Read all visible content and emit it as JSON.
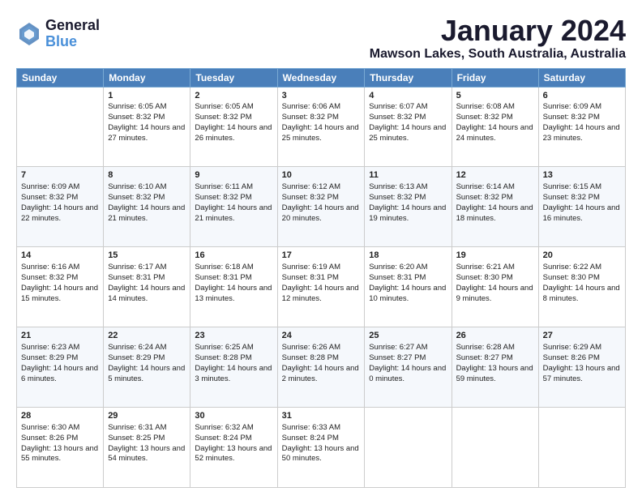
{
  "header": {
    "logo_line1": "General",
    "logo_line2": "Blue",
    "month_title": "January 2024",
    "location": "Mawson Lakes, South Australia, Australia"
  },
  "weekdays": [
    "Sunday",
    "Monday",
    "Tuesday",
    "Wednesday",
    "Thursday",
    "Friday",
    "Saturday"
  ],
  "weeks": [
    [
      {
        "day": "",
        "sunrise": "",
        "sunset": "",
        "daylight": "",
        "empty": true
      },
      {
        "day": "1",
        "sunrise": "Sunrise: 6:05 AM",
        "sunset": "Sunset: 8:32 PM",
        "daylight": "Daylight: 14 hours and 27 minutes."
      },
      {
        "day": "2",
        "sunrise": "Sunrise: 6:05 AM",
        "sunset": "Sunset: 8:32 PM",
        "daylight": "Daylight: 14 hours and 26 minutes."
      },
      {
        "day": "3",
        "sunrise": "Sunrise: 6:06 AM",
        "sunset": "Sunset: 8:32 PM",
        "daylight": "Daylight: 14 hours and 25 minutes."
      },
      {
        "day": "4",
        "sunrise": "Sunrise: 6:07 AM",
        "sunset": "Sunset: 8:32 PM",
        "daylight": "Daylight: 14 hours and 25 minutes."
      },
      {
        "day": "5",
        "sunrise": "Sunrise: 6:08 AM",
        "sunset": "Sunset: 8:32 PM",
        "daylight": "Daylight: 14 hours and 24 minutes."
      },
      {
        "day": "6",
        "sunrise": "Sunrise: 6:09 AM",
        "sunset": "Sunset: 8:32 PM",
        "daylight": "Daylight: 14 hours and 23 minutes."
      }
    ],
    [
      {
        "day": "7",
        "sunrise": "Sunrise: 6:09 AM",
        "sunset": "Sunset: 8:32 PM",
        "daylight": "Daylight: 14 hours and 22 minutes."
      },
      {
        "day": "8",
        "sunrise": "Sunrise: 6:10 AM",
        "sunset": "Sunset: 8:32 PM",
        "daylight": "Daylight: 14 hours and 21 minutes."
      },
      {
        "day": "9",
        "sunrise": "Sunrise: 6:11 AM",
        "sunset": "Sunset: 8:32 PM",
        "daylight": "Daylight: 14 hours and 21 minutes."
      },
      {
        "day": "10",
        "sunrise": "Sunrise: 6:12 AM",
        "sunset": "Sunset: 8:32 PM",
        "daylight": "Daylight: 14 hours and 20 minutes."
      },
      {
        "day": "11",
        "sunrise": "Sunrise: 6:13 AM",
        "sunset": "Sunset: 8:32 PM",
        "daylight": "Daylight: 14 hours and 19 minutes."
      },
      {
        "day": "12",
        "sunrise": "Sunrise: 6:14 AM",
        "sunset": "Sunset: 8:32 PM",
        "daylight": "Daylight: 14 hours and 18 minutes."
      },
      {
        "day": "13",
        "sunrise": "Sunrise: 6:15 AM",
        "sunset": "Sunset: 8:32 PM",
        "daylight": "Daylight: 14 hours and 16 minutes."
      }
    ],
    [
      {
        "day": "14",
        "sunrise": "Sunrise: 6:16 AM",
        "sunset": "Sunset: 8:32 PM",
        "daylight": "Daylight: 14 hours and 15 minutes."
      },
      {
        "day": "15",
        "sunrise": "Sunrise: 6:17 AM",
        "sunset": "Sunset: 8:31 PM",
        "daylight": "Daylight: 14 hours and 14 minutes."
      },
      {
        "day": "16",
        "sunrise": "Sunrise: 6:18 AM",
        "sunset": "Sunset: 8:31 PM",
        "daylight": "Daylight: 14 hours and 13 minutes."
      },
      {
        "day": "17",
        "sunrise": "Sunrise: 6:19 AM",
        "sunset": "Sunset: 8:31 PM",
        "daylight": "Daylight: 14 hours and 12 minutes."
      },
      {
        "day": "18",
        "sunrise": "Sunrise: 6:20 AM",
        "sunset": "Sunset: 8:31 PM",
        "daylight": "Daylight: 14 hours and 10 minutes."
      },
      {
        "day": "19",
        "sunrise": "Sunrise: 6:21 AM",
        "sunset": "Sunset: 8:30 PM",
        "daylight": "Daylight: 14 hours and 9 minutes."
      },
      {
        "day": "20",
        "sunrise": "Sunrise: 6:22 AM",
        "sunset": "Sunset: 8:30 PM",
        "daylight": "Daylight: 14 hours and 8 minutes."
      }
    ],
    [
      {
        "day": "21",
        "sunrise": "Sunrise: 6:23 AM",
        "sunset": "Sunset: 8:29 PM",
        "daylight": "Daylight: 14 hours and 6 minutes."
      },
      {
        "day": "22",
        "sunrise": "Sunrise: 6:24 AM",
        "sunset": "Sunset: 8:29 PM",
        "daylight": "Daylight: 14 hours and 5 minutes."
      },
      {
        "day": "23",
        "sunrise": "Sunrise: 6:25 AM",
        "sunset": "Sunset: 8:28 PM",
        "daylight": "Daylight: 14 hours and 3 minutes."
      },
      {
        "day": "24",
        "sunrise": "Sunrise: 6:26 AM",
        "sunset": "Sunset: 8:28 PM",
        "daylight": "Daylight: 14 hours and 2 minutes."
      },
      {
        "day": "25",
        "sunrise": "Sunrise: 6:27 AM",
        "sunset": "Sunset: 8:27 PM",
        "daylight": "Daylight: 14 hours and 0 minutes."
      },
      {
        "day": "26",
        "sunrise": "Sunrise: 6:28 AM",
        "sunset": "Sunset: 8:27 PM",
        "daylight": "Daylight: 13 hours and 59 minutes."
      },
      {
        "day": "27",
        "sunrise": "Sunrise: 6:29 AM",
        "sunset": "Sunset: 8:26 PM",
        "daylight": "Daylight: 13 hours and 57 minutes."
      }
    ],
    [
      {
        "day": "28",
        "sunrise": "Sunrise: 6:30 AM",
        "sunset": "Sunset: 8:26 PM",
        "daylight": "Daylight: 13 hours and 55 minutes."
      },
      {
        "day": "29",
        "sunrise": "Sunrise: 6:31 AM",
        "sunset": "Sunset: 8:25 PM",
        "daylight": "Daylight: 13 hours and 54 minutes."
      },
      {
        "day": "30",
        "sunrise": "Sunrise: 6:32 AM",
        "sunset": "Sunset: 8:24 PM",
        "daylight": "Daylight: 13 hours and 52 minutes."
      },
      {
        "day": "31",
        "sunrise": "Sunrise: 6:33 AM",
        "sunset": "Sunset: 8:24 PM",
        "daylight": "Daylight: 13 hours and 50 minutes."
      },
      {
        "day": "",
        "sunrise": "",
        "sunset": "",
        "daylight": "",
        "empty": true
      },
      {
        "day": "",
        "sunrise": "",
        "sunset": "",
        "daylight": "",
        "empty": true
      },
      {
        "day": "",
        "sunrise": "",
        "sunset": "",
        "daylight": "",
        "empty": true
      }
    ]
  ]
}
